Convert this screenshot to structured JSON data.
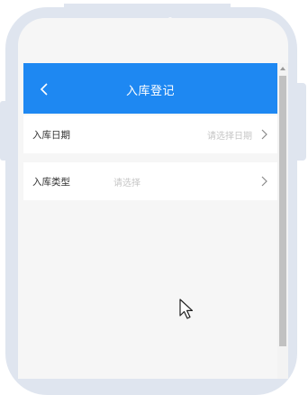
{
  "header": {
    "title": "入库登记",
    "back_icon": "chevron-left-icon"
  },
  "form": {
    "date_row": {
      "label": "入库日期",
      "placeholder": "请选择日期",
      "icon": "chevron-right-icon"
    },
    "type_row": {
      "label": "入库类型",
      "placeholder": "请选择",
      "icon": "chevron-right-icon"
    }
  },
  "colors": {
    "accent": "#1e88f2",
    "frame": "#dfe5ef",
    "placeholder_text": "#c6c6c6",
    "label_text": "#333333"
  }
}
